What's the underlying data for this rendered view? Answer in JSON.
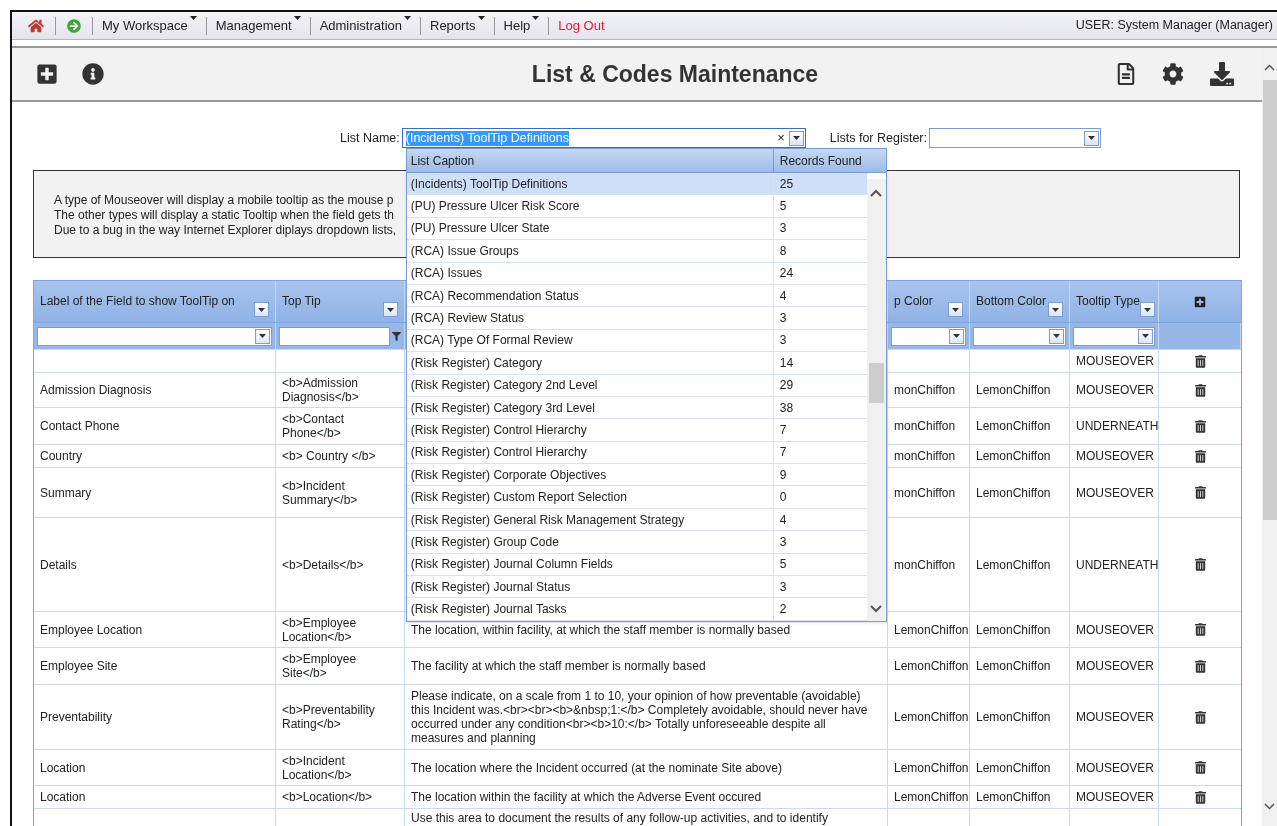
{
  "nav": {
    "menus": [
      {
        "label": "My Workspace",
        "kind": "menu"
      },
      {
        "label": "Management",
        "kind": "menu"
      },
      {
        "label": "Administration",
        "kind": "menu"
      },
      {
        "label": "Reports",
        "kind": "menu"
      },
      {
        "label": "Help",
        "kind": "menu"
      },
      {
        "label": "Log Out",
        "kind": "link"
      }
    ],
    "user": "USER: System Manager (Manager)"
  },
  "title": "List & Codes Maintenance",
  "list_name": {
    "label": "List Name:",
    "value": "(Incidents) ToolTip Definitions",
    "clear": "×"
  },
  "register": {
    "label": "Lists for Register:"
  },
  "dropdown": {
    "columns": [
      "List Caption",
      "Records Found"
    ],
    "items": [
      {
        "caption": "(Incidents) ToolTip Definitions",
        "count": "25",
        "selected": true
      },
      {
        "caption": "(PU) Pressure Ulcer Risk Score",
        "count": "5",
        "selected": false
      },
      {
        "caption": "(PU) Pressure Ulcer State",
        "count": "3",
        "selected": false
      },
      {
        "caption": "(RCA) Issue Groups",
        "count": "8",
        "selected": false
      },
      {
        "caption": "(RCA) Issues",
        "count": "24",
        "selected": false
      },
      {
        "caption": "(RCA) Recommendation Status",
        "count": "4",
        "selected": false
      },
      {
        "caption": "(RCA) Review Status",
        "count": "3",
        "selected": false
      },
      {
        "caption": "(RCA) Type Of Formal Review",
        "count": "3",
        "selected": false
      },
      {
        "caption": "(Risk Register) Category",
        "count": "14",
        "selected": false
      },
      {
        "caption": "(Risk Register) Category 2nd Level",
        "count": "29",
        "selected": false
      },
      {
        "caption": "(Risk Register) Category 3rd Level",
        "count": "38",
        "selected": false
      },
      {
        "caption": "(Risk Register) Control Hierarchy",
        "count": "7",
        "selected": false
      },
      {
        "caption": "(Risk Register) Control Hierarchy",
        "count": "7",
        "selected": false
      },
      {
        "caption": "(Risk Register) Corporate Objectives",
        "count": "9",
        "selected": false
      },
      {
        "caption": "(Risk Register) Custom Report Selection",
        "count": "0",
        "selected": false
      },
      {
        "caption": "(Risk Register) General Risk Management Strategy",
        "count": "4",
        "selected": false
      },
      {
        "caption": "(Risk Register) Group Code",
        "count": "3",
        "selected": false
      },
      {
        "caption": "(Risk Register) Journal Column Fields",
        "count": "5",
        "selected": false
      },
      {
        "caption": "(Risk Register) Journal Status",
        "count": "3",
        "selected": false
      },
      {
        "caption": "(Risk Register) Journal Tasks",
        "count": "2",
        "selected": false
      }
    ]
  },
  "info": [
    "A type of Mouseover will display a mobile tooltip as the mouse p",
    "The other types will display a static Tooltip when the field gets th",
    "Due to a bug in the way Internet Explorer diplays dropdown lists,"
  ],
  "table": {
    "columns": [
      {
        "label": "Label of the Field to show ToolTip on",
        "kind": "select"
      },
      {
        "label": "Top Tip",
        "kind": "text"
      },
      {
        "kind": "hidden"
      },
      {
        "label": "p Color",
        "kind": "select"
      },
      {
        "label": "Bottom Color",
        "kind": "select"
      },
      {
        "label": "Tooltip Type",
        "kind": "select"
      },
      {
        "kind": "add"
      }
    ],
    "rows": [
      {
        "kind": "row",
        "tooltip_type": "MOUSEOVER"
      },
      {
        "kind": "row",
        "field": "Admission Diagnosis",
        "top_tip": "<b>Admission Diagnosis</b>",
        "top_color": "monChiffon",
        "bottom_color": "LemonChiffon",
        "tooltip_type": "MOUSEOVER"
      },
      {
        "kind": "row",
        "field": "Contact Phone",
        "top_tip": "<b>Contact Phone</b>",
        "top_color": "monChiffon",
        "bottom_color": "LemonChiffon",
        "tooltip_type": "UNDERNEATH"
      },
      {
        "kind": "row",
        "field": "Country",
        "top_tip": "<b> Country </b>",
        "top_color": "monChiffon",
        "bottom_color": "LemonChiffon",
        "tooltip_type": "MOUSEOVER"
      },
      {
        "kind": "row",
        "field": "Summary",
        "top_tip": "<b>Incident Summary</b>",
        "top_color": "monChiffon",
        "bottom_color": "LemonChiffon",
        "tooltip_type": "MOUSEOVER"
      },
      {
        "kind": "row",
        "field": "Details",
        "top_tip": "<b>Details</b>",
        "top_color": "monChiffon",
        "bottom_color": "LemonChiffon",
        "tooltip_type": "UNDERNEATH"
      },
      {
        "kind": "row",
        "field": "Employee Location",
        "top_tip": "<b>Employee Location</b>",
        "tooltip": "The location, within facility, at which the staff member is normally based",
        "top_color": "LemonChiffon",
        "bottom_color": "LemonChiffon",
        "tooltip_type": "MOUSEOVER"
      },
      {
        "kind": "row",
        "field": "Employee Site",
        "top_tip": "<b>Employee Site</b>",
        "tooltip": "The facility at which the staff member is normally based",
        "top_color": "LemonChiffon",
        "bottom_color": "LemonChiffon",
        "tooltip_type": "MOUSEOVER"
      },
      {
        "kind": "row",
        "field": "Preventability",
        "top_tip": "<b>Preventability Rating</b>",
        "tooltip": "Please indicate, on a scale from 1 to 10, your opinion of how preventable (avoidable) this Incident was.<br><br><b>&nbsp;1:</b> Completely avoidable, should never have occurred under any condition<br><b>10:</b> Totally unforeseeable despite all measures and planning",
        "top_color": "LemonChiffon",
        "bottom_color": "LemonChiffon",
        "tooltip_type": "MOUSEOVER"
      },
      {
        "kind": "row",
        "field": "Location",
        "top_tip": "<b>Incident Location</b>",
        "tooltip": "The location where the Incident occurred (at the nominate Site above)",
        "top_color": "LemonChiffon",
        "bottom_color": "LemonChiffon",
        "tooltip_type": "MOUSEOVER"
      },
      {
        "kind": "row",
        "field": "Location",
        "top_tip": "<b>Location</b>",
        "tooltip": "The location within the facility at which the Adverse Event occured",
        "top_color": "LemonChiffon",
        "bottom_color": "LemonChiffon",
        "tooltip_type": "MOUSEOVER"
      },
      {
        "kind": "partial",
        "tooltip": "Use this area to document the results of any follow-up activities, and to identify"
      }
    ]
  }
}
